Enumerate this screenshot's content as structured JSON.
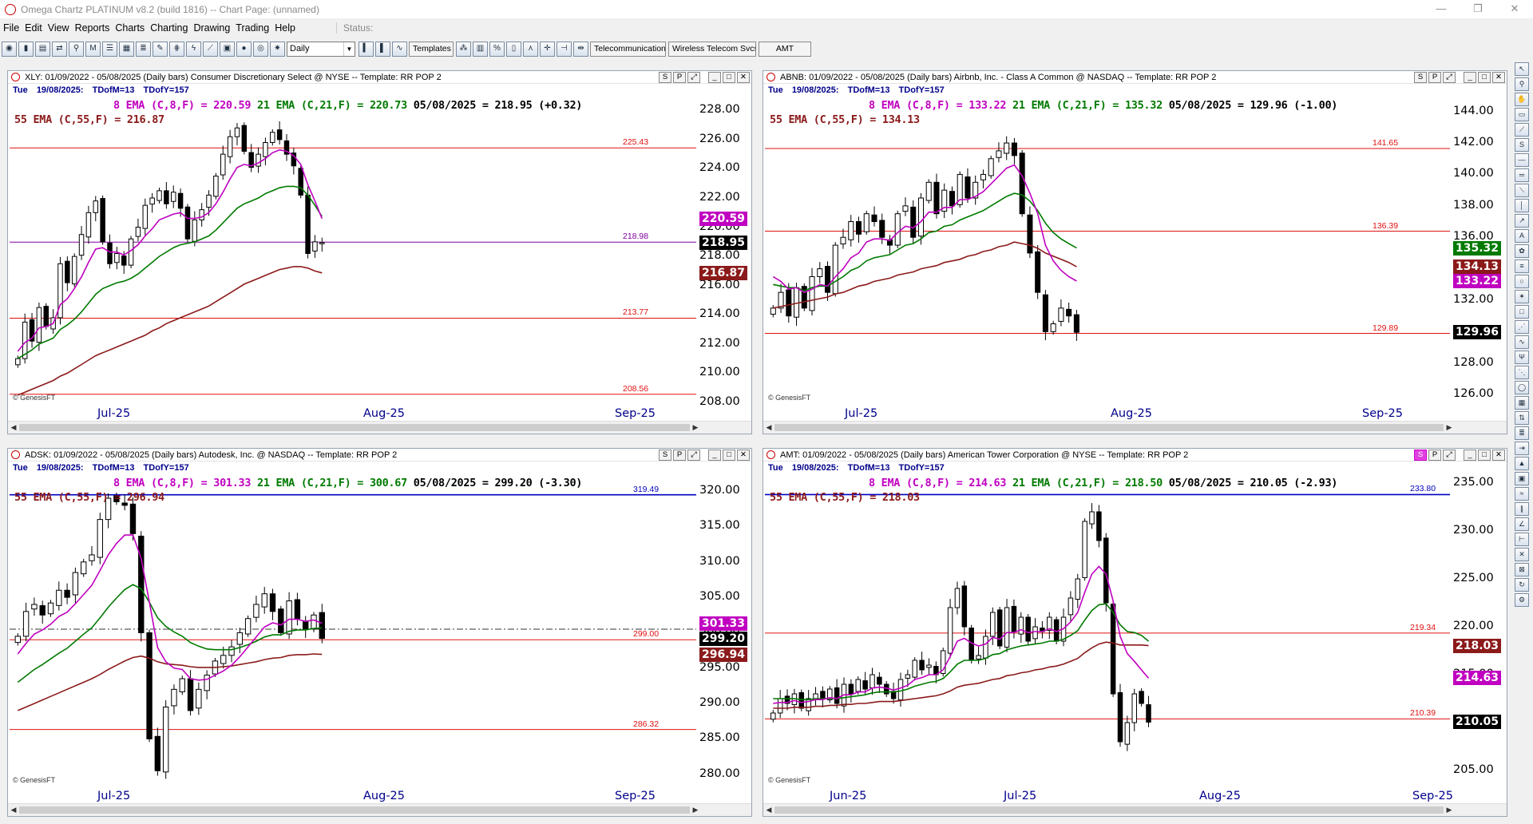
{
  "window": {
    "title": "Omega Chartz PLATINUM v8.2 (build 1816)  --  Chart Page: (unnamed)"
  },
  "menu": [
    "File",
    "Edit",
    "View",
    "Reports",
    "Charts",
    "Charting",
    "Drawing",
    "Trading",
    "Help"
  ],
  "status_label": "Status:",
  "toolbar": {
    "period_select": "Daily",
    "templates_label": "Templates",
    "industry_field": "Telecommunication Ser",
    "group_field": "Wireless Telecom Svcs",
    "symbol_field": "AMT"
  },
  "colors": {
    "ema8": "#c000c0",
    "ema21": "#007a00",
    "ema55": "#8b1a1a",
    "level_red": "#e01010",
    "level_blue": "#0000c0"
  },
  "panels": [
    {
      "id": "xly",
      "header": "XLY:  01/09/2022 - 05/08/2025  (Daily bars)   Consumer Discretionary Select @ NYSE  --  Template: RR POP 2",
      "day": "Tue",
      "date": "19/08/2025:",
      "tdofm": "TDofM=13",
      "tdofy": "TDofY=157",
      "ema8": "8 EMA (C,8,F) = 220.59",
      "ema21": "21 EMA (C,21,F) = 220.73",
      "close": "05/08/2025 = 218.95 (+0.32)",
      "ema55": "55 EMA (C,55,F) = 216.87",
      "yticks": [
        "228.00",
        "226.00",
        "224.00",
        "222.00",
        "220.00",
        "218.00",
        "216.00",
        "214.00",
        "212.00",
        "210.00",
        "208.00"
      ],
      "tags": {
        "ema8": "220.59",
        "close": "218.95",
        "ema55": "216.87"
      },
      "levels": [
        "225.43",
        "218.98",
        "213.77",
        "208.56"
      ],
      "xticks": [
        "Jul-25",
        "Aug-25",
        "Sep-25"
      ],
      "credit": "© GenesisFT"
    },
    {
      "id": "abnb",
      "header": "ABNB:  01/09/2022 - 05/08/2025  (Daily bars)   Airbnb, Inc. - Class A Common @ NASDAQ  --  Template: RR POP 2",
      "day": "Tue",
      "date": "19/08/2025:",
      "tdofm": "TDofM=13",
      "tdofy": "TDofY=157",
      "ema8": "8 EMA (C,8,F) = 133.22",
      "ema21": "21 EMA (C,21,F) = 135.32",
      "close": "05/08/2025 = 129.96 (-1.00)",
      "ema55": "55 EMA (C,55,F) = 134.13",
      "yticks": [
        "144.00",
        "142.00",
        "140.00",
        "138.00",
        "136.00",
        "134.00",
        "132.00",
        "130.00",
        "128.00",
        "126.00"
      ],
      "tags": {
        "ema21": "135.32",
        "ema55": "134.13",
        "ema8": "133.22",
        "close": "129.96"
      },
      "levels": [
        "141.65",
        "136.39",
        "129.89"
      ],
      "xticks": [
        "Jul-25",
        "Aug-25",
        "Sep-25"
      ],
      "credit": "© GenesisFT"
    },
    {
      "id": "adsk",
      "header": "ADSK:  01/09/2022 - 05/08/2025  (Daily bars)   Autodesk, Inc. @ NASDAQ  --  Template: RR POP 2",
      "day": "Tue",
      "date": "19/08/2025:",
      "tdofm": "TDofM=13",
      "tdofy": "TDofY=157",
      "ema8": "8 EMA (C,8,F) = 301.33",
      "ema21": "21 EMA (C,21,F) = 300.67",
      "close": "05/08/2025 = 299.20 (-3.30)",
      "ema55": "55 EMA (C,55,F) = 296.94",
      "yticks": [
        "320.00",
        "315.00",
        "310.00",
        "305.00",
        "300.00",
        "295.00",
        "290.00",
        "285.00",
        "280.00"
      ],
      "tags": {
        "ema8": "301.33",
        "close": "299.20",
        "ema55": "296.94"
      },
      "levels": [
        "319.49",
        "299.00",
        "286.32"
      ],
      "xticks": [
        "Jul-25",
        "Aug-25",
        "Sep-25"
      ],
      "credit": "© GenesisFT"
    },
    {
      "id": "amt",
      "header": "AMT:  01/09/2022 - 05/08/2025  (Daily bars)   American Tower Corporation @ NYSE  --  Template: RR POP 2",
      "day": "Tue",
      "date": "19/08/2025:",
      "tdofm": "TDofM=13",
      "tdofy": "TDofY=157",
      "ema8": "8 EMA (C,8,F) = 214.63",
      "ema21": "21 EMA (C,21,F) = 218.50",
      "close": "05/08/2025 = 210.05 (-2.93)",
      "ema55": "55 EMA (C,55,F) = 218.03",
      "yticks": [
        "235.00",
        "230.00",
        "225.00",
        "220.00",
        "215.00",
        "210.00",
        "205.00"
      ],
      "tags": {
        "ema55": "218.03",
        "ema8": "214.63",
        "close": "210.05"
      },
      "levels": [
        "233.80",
        "219.34",
        "210.39"
      ],
      "xticks": [
        "Jun-25",
        "Jul-25",
        "Aug-25",
        "Sep-25"
      ],
      "credit": "© GenesisFT"
    }
  ],
  "chart_data": [
    {
      "type": "candlestick",
      "symbol": "XLY",
      "ylim": [
        208,
        229
      ],
      "xticks": [
        "Jul-25",
        "Aug-25",
        "Sep-25"
      ],
      "closes": [
        211,
        213.5,
        212.2,
        214.5,
        213.2,
        213.8,
        217.5,
        216.2,
        218,
        219.5,
        221,
        221.8,
        219,
        217.5,
        218.2,
        217.4,
        219.2,
        220,
        221.5,
        222,
        222.5,
        221.6,
        222.4,
        221.3,
        219.2,
        220.5,
        221.2,
        222.2,
        223.5,
        225,
        226.2,
        226.8,
        225.2,
        224.1,
        225,
        225.8,
        226.5,
        226,
        225,
        224.2,
        222.2,
        218.2,
        219,
        218.95
      ],
      "ema8": [
        211.5,
        212.1,
        212.4,
        213.1,
        213.2,
        213.4,
        214.7,
        215.1,
        215.8,
        216.6,
        217.6,
        218.5,
        218.6,
        218.3,
        218.3,
        218.1,
        218.4,
        218.8,
        219.4,
        219.9,
        220.5,
        220.7,
        220.9,
        221,
        220.6,
        220.6,
        220.7,
        221,
        221.6,
        222.4,
        223.3,
        224.1,
        224.3,
        224.2,
        224.4,
        224.7,
        225.1,
        225.3,
        225.2,
        224.9,
        224.3,
        222.9,
        221.8,
        220.59
      ],
      "ema21": [
        211,
        211.3,
        211.6,
        212,
        212.2,
        212.4,
        213,
        213.3,
        213.7,
        214.2,
        214.8,
        215.4,
        215.8,
        216,
        216.2,
        216.3,
        216.5,
        216.8,
        217.2,
        217.6,
        218,
        218.3,
        218.6,
        218.8,
        218.9,
        219,
        219.2,
        219.4,
        219.8,
        220.3,
        220.8,
        221.3,
        221.6,
        221.8,
        222,
        222.3,
        222.5,
        222.7,
        222.8,
        222.8,
        222.7,
        222.2,
        221.5,
        220.73
      ],
      "ema55": [
        208.5,
        208.7,
        208.9,
        209.1,
        209.3,
        209.5,
        209.8,
        210,
        210.3,
        210.6,
        210.9,
        211.2,
        211.4,
        211.6,
        211.8,
        212,
        212.2,
        212.4,
        212.6,
        212.9,
        213.1,
        213.4,
        213.6,
        213.8,
        214,
        214.2,
        214.4,
        214.6,
        214.9,
        215.2,
        215.5,
        215.8,
        216.1,
        216.3,
        216.5,
        216.7,
        216.9,
        217.1,
        217.2,
        217.3,
        217.3,
        217.2,
        217,
        216.87
      ],
      "levels": [
        225.43,
        218.98,
        213.77,
        208.56
      ]
    },
    {
      "type": "candlestick",
      "symbol": "ABNB",
      "ylim": [
        125.5,
        145
      ],
      "xticks": [
        "Jul-25",
        "Aug-25",
        "Sep-25"
      ],
      "closes": [
        131.5,
        132.5,
        131,
        132.8,
        131.5,
        133.5,
        134,
        132.5,
        135.5,
        136,
        137,
        136.2,
        137.5,
        137,
        136,
        135.5,
        137.5,
        138,
        136,
        138.5,
        139.5,
        137.5,
        139,
        138,
        140,
        138.5,
        139.5,
        140,
        141,
        141.5,
        142,
        141.2,
        137.5,
        135,
        132.5,
        130,
        130.5,
        131.5,
        131,
        129.96
      ],
      "ema8": [
        133.5,
        133.2,
        132.7,
        132.8,
        132.5,
        132.7,
        133,
        132.9,
        133.5,
        134,
        134.7,
        135,
        135.7,
        135.9,
        135.9,
        135.8,
        136.3,
        136.7,
        136.6,
        137,
        137.6,
        137.6,
        137.9,
        137.9,
        138.4,
        138.4,
        138.6,
        138.9,
        139.4,
        139.9,
        140.4,
        140.6,
        139.9,
        138.8,
        137.5,
        135.5,
        134.5,
        133.9,
        133.5,
        133.22
      ],
      "ema21": [
        133,
        132.9,
        132.8,
        132.8,
        132.6,
        132.8,
        132.9,
        132.9,
        133.2,
        133.5,
        133.9,
        134.1,
        134.5,
        134.7,
        134.8,
        134.9,
        135.2,
        135.5,
        135.6,
        135.9,
        136.3,
        136.4,
        136.7,
        136.8,
        137.1,
        137.3,
        137.5,
        137.7,
        138,
        138.3,
        138.6,
        138.8,
        138.7,
        138.3,
        137.7,
        136.9,
        136.3,
        135.9,
        135.6,
        135.32
      ],
      "ema55": [
        131.5,
        131.6,
        131.7,
        131.8,
        131.9,
        132,
        132.1,
        132.2,
        132.4,
        132.5,
        132.7,
        132.9,
        133,
        133.2,
        133.3,
        133.4,
        133.6,
        133.7,
        133.8,
        134,
        134.1,
        134.2,
        134.4,
        134.5,
        134.6,
        134.8,
        134.9,
        135.1,
        135.2,
        135.4,
        135.5,
        135.7,
        135.6,
        135.5,
        135.3,
        135,
        134.8,
        134.6,
        134.4,
        134.13
      ],
      "levels": [
        141.65,
        136.39,
        129.89
      ]
    },
    {
      "type": "candlestick",
      "symbol": "ADSK",
      "ylim": [
        278.5,
        322.5
      ],
      "xticks": [
        "Jul-25",
        "Aug-25",
        "Sep-25"
      ],
      "closes": [
        299.5,
        303,
        304,
        302.5,
        304.2,
        306,
        305,
        308.5,
        310,
        311,
        316,
        319,
        318.5,
        318,
        314,
        300,
        285,
        280.5,
        289.5,
        292,
        293.5,
        289,
        292,
        294,
        296,
        296.8,
        298,
        300,
        302,
        304,
        305.5,
        303,
        300,
        304.5,
        302,
        300.5,
        302.5,
        299.2
      ],
      "ema8": [
        297,
        298.5,
        299.8,
        300.4,
        301.2,
        302.3,
        302.9,
        304.1,
        305.4,
        306.7,
        308.8,
        311,
        312.6,
        313.8,
        313.8,
        310.5,
        304.3,
        297.9,
        295.9,
        295,
        294.8,
        293.5,
        293.3,
        293.4,
        294,
        294.6,
        295.4,
        296.6,
        298,
        299.4,
        300.8,
        301.4,
        301.1,
        301.9,
        301.9,
        301.6,
        301.8,
        301.33
      ],
      "ema21": [
        293,
        293.9,
        294.8,
        295.5,
        296.3,
        297.1,
        297.8,
        298.8,
        299.8,
        300.7,
        302.1,
        303.6,
        304.9,
        306.1,
        306.8,
        306.2,
        304.3,
        302.1,
        300.9,
        300.1,
        299.5,
        298.6,
        298.1,
        297.7,
        297.6,
        297.6,
        297.6,
        297.9,
        298.3,
        298.8,
        299.4,
        299.7,
        299.7,
        300.2,
        300.4,
        300.4,
        300.6,
        300.67
      ],
      "ema55": [
        289,
        289.5,
        290,
        290.5,
        291,
        291.5,
        292,
        292.5,
        293,
        293.5,
        294.1,
        294.8,
        295.4,
        296,
        296.5,
        296.7,
        296.4,
        295.9,
        295.6,
        295.5,
        295.4,
        295.2,
        295.1,
        295.1,
        295.1,
        295.2,
        295.3,
        295.5,
        295.7,
        295.9,
        296.2,
        296.4,
        296.5,
        296.8,
        296.9,
        296.9,
        297,
        296.94
      ],
      "levels": [
        319.49,
        299,
        286.32
      ]
    },
    {
      "type": "candlestick",
      "symbol": "AMT",
      "ylim": [
        203.5,
        236
      ],
      "xticks": [
        "Jun-25",
        "Jul-25",
        "Aug-25",
        "Sep-25"
      ],
      "closes": [
        211,
        212.5,
        212,
        213,
        211.5,
        212.5,
        213,
        212.5,
        213.5,
        212,
        214,
        213,
        214.5,
        213.5,
        215,
        214,
        213,
        212.5,
        214.5,
        215,
        216.5,
        215.5,
        216,
        215,
        217.5,
        222,
        224,
        220,
        216.5,
        217,
        219,
        221.5,
        218,
        222,
        219.5,
        221,
        218.5,
        220,
        219.5,
        221,
        218.5,
        221,
        223,
        225,
        231,
        232,
        229,
        222.5,
        213,
        208,
        210,
        213,
        212,
        210.05
      ],
      "ema8": [
        212,
        212.1,
        212.1,
        212.3,
        212.1,
        212.2,
        212.4,
        212.4,
        212.6,
        212.5,
        212.9,
        212.9,
        213.2,
        213.2,
        213.6,
        213.7,
        213.6,
        213.4,
        213.6,
        213.9,
        214.5,
        214.7,
        215,
        215,
        215.5,
        216.9,
        218.5,
        218.8,
        218.3,
        218,
        218.2,
        218.9,
        218.7,
        219.4,
        219.4,
        219.7,
        219.4,
        219.5,
        219.5,
        219.8,
        219.5,
        219.8,
        220.5,
        221.5,
        223.6,
        225.5,
        226.3,
        225.5,
        222.7,
        219,
        217.2,
        216.4,
        215.5,
        214.63
      ],
      "ema21": [
        212.5,
        212.5,
        212.5,
        212.5,
        212.4,
        212.4,
        212.5,
        212.5,
        212.5,
        212.5,
        212.6,
        212.7,
        212.8,
        212.9,
        213.1,
        213.2,
        213.2,
        213.2,
        213.3,
        213.5,
        213.8,
        214,
        214.2,
        214.3,
        214.6,
        215.3,
        216.1,
        216.5,
        216.5,
        216.5,
        216.7,
        217.1,
        217.2,
        217.6,
        217.8,
        218,
        218.1,
        218.2,
        218.3,
        218.5,
        218.5,
        218.7,
        219.1,
        219.6,
        220.7,
        221.7,
        222.3,
        222.4,
        221.5,
        220.2,
        219.5,
        219.4,
        219.1,
        218.5
      ],
      "ema55": [
        211.5,
        211.5,
        211.5,
        211.6,
        211.6,
        211.6,
        211.7,
        211.7,
        211.8,
        211.8,
        211.9,
        211.9,
        212,
        212,
        212.1,
        212.2,
        212.2,
        212.2,
        212.3,
        212.4,
        212.5,
        212.6,
        212.7,
        212.8,
        213,
        213.3,
        213.7,
        213.9,
        214,
        214.1,
        214.3,
        214.5,
        214.6,
        214.9,
        215,
        215.2,
        215.3,
        215.5,
        215.6,
        215.8,
        215.9,
        216.1,
        216.4,
        216.7,
        217.3,
        217.8,
        218.2,
        218.4,
        218.3,
        218.1,
        218.1,
        218.1,
        218.1,
        218.03
      ],
      "levels": [
        233.8,
        219.34,
        210.39
      ]
    }
  ]
}
